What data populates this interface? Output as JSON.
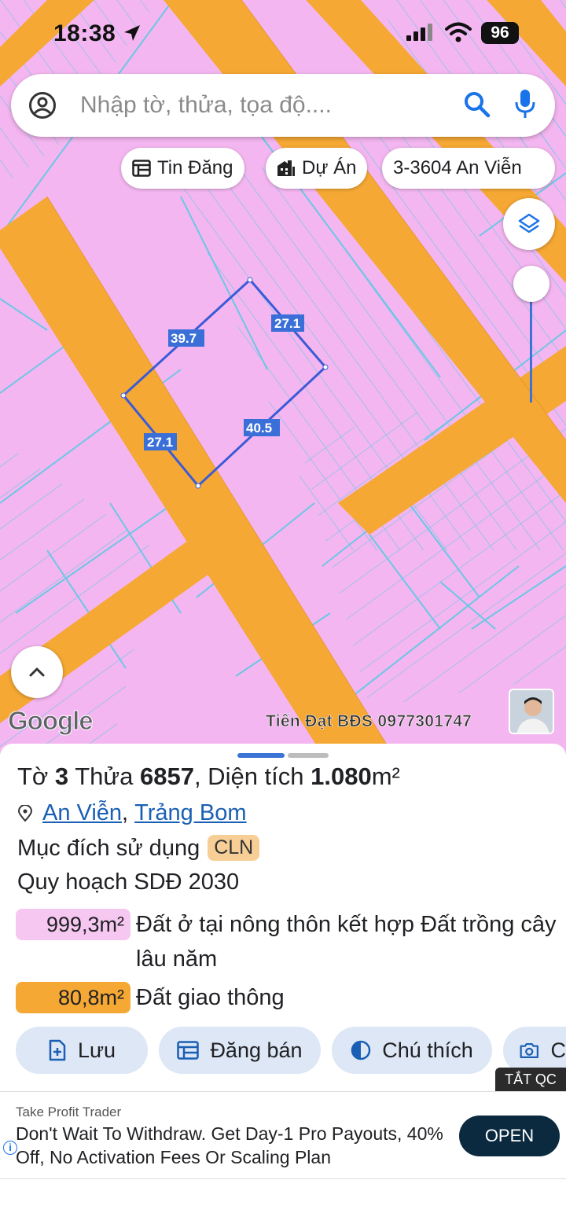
{
  "status_bar": {
    "time": "18:38",
    "battery": "96"
  },
  "search": {
    "placeholder": "Nhập tờ, thửa, tọa độ...."
  },
  "chips": [
    {
      "label": "Tin Đăng",
      "icon": "list-icon"
    },
    {
      "label": "Dự Án",
      "icon": "building-icon"
    },
    {
      "label": "3-3604 An Viễn",
      "icon": ""
    }
  ],
  "map": {
    "parcel_edges": [
      "39.7",
      "27.1",
      "27.1",
      "40.5"
    ],
    "google_logo": "Google",
    "watermark": "Tiến Đạt BĐS 0977301747",
    "colors": {
      "residential": "#f4b6f0",
      "road": "#f5a833",
      "lot_lines": "#6cc6e4",
      "parcel": "#3b5bd6"
    }
  },
  "sheet": {
    "title_prefix": "Tờ ",
    "sheet_no": "3",
    "plot_word": " Thửa ",
    "plot_no": "6857",
    "area_label": ", Diện tích ",
    "area_value": "1.080",
    "area_unit": "m²",
    "ward": "An Viễn",
    "separator": ",",
    "district": "Trảng Bom",
    "purpose_label": "Mục đích sử dụng",
    "purpose_code": "CLN",
    "plan_label": "Quy hoạch SDĐ 2030",
    "zones": [
      {
        "area": "999,3m²",
        "desc": "Đất ở tại nông thôn kết hợp Đất trồng cây lâu năm",
        "color": "#f6c7f1"
      },
      {
        "area": "80,8m²",
        "desc": "Đất giao thông",
        "color": "#f5a833"
      }
    ],
    "actions": [
      {
        "label": "Lưu",
        "icon": "save-add-icon"
      },
      {
        "label": "Đăng bán",
        "icon": "post-icon"
      },
      {
        "label": "Chú thích",
        "icon": "legend-icon"
      },
      {
        "label": "C",
        "icon": "camera-icon"
      }
    ]
  },
  "ad": {
    "close_label": "TẮT QC",
    "brand": "Take Profit Trader",
    "text": "Don't Wait To Withdraw. Get Day-1 Pro Payouts, 40% Off, No Activation Fees Or Scaling Plan",
    "cta": "OPEN",
    "info": "i"
  }
}
